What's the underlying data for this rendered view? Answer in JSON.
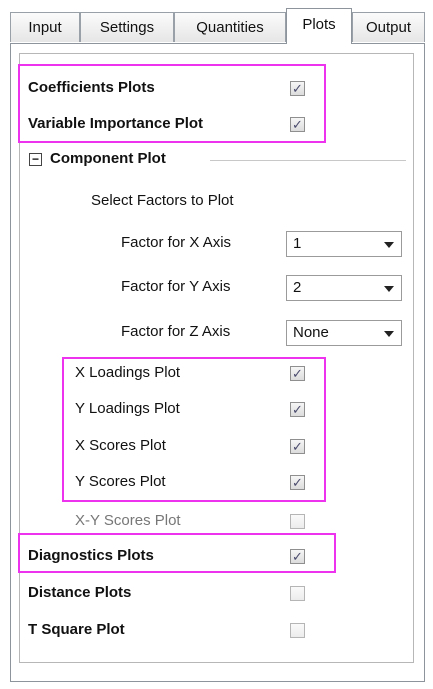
{
  "tabs": [
    {
      "label": "Input",
      "active": false
    },
    {
      "label": "Settings",
      "active": false
    },
    {
      "label": "Quantities",
      "active": false
    },
    {
      "label": "Plots",
      "active": true
    },
    {
      "label": "Output",
      "active": false
    }
  ],
  "top_options": {
    "coefficients_plots": {
      "label": "Coefficients Plots",
      "checked": true
    },
    "variable_importance_plot": {
      "label": "Variable Importance Plot",
      "checked": true
    }
  },
  "component_plot": {
    "header": "Component Plot",
    "expanded": true,
    "select_factors_label": "Select Factors to Plot",
    "factor_x": {
      "label": "Factor for X Axis",
      "value": "1"
    },
    "factor_y": {
      "label": "Factor for Y Axis",
      "value": "2"
    },
    "factor_z": {
      "label": "Factor for Z Axis",
      "value": "None"
    },
    "x_loadings": {
      "label": "X Loadings Plot",
      "checked": true
    },
    "y_loadings": {
      "label": "Y Loadings Plot",
      "checked": true
    },
    "x_scores": {
      "label": "X Scores Plot",
      "checked": true
    },
    "y_scores": {
      "label": "Y Scores Plot",
      "checked": true
    },
    "xy_scores": {
      "label": "X-Y Scores Plot",
      "checked": false,
      "disabled": true
    }
  },
  "bottom_options": {
    "diagnostics_plots": {
      "label": "Diagnostics Plots",
      "checked": true
    },
    "distance_plots": {
      "label": "Distance Plots",
      "checked": false
    },
    "t_square_plot": {
      "label": "T Square Plot",
      "checked": false
    }
  },
  "glyphs": {
    "check": "✓",
    "collapse": "−"
  },
  "colors": {
    "highlight": "#ee33ee",
    "panel_border": "#8e949c"
  }
}
